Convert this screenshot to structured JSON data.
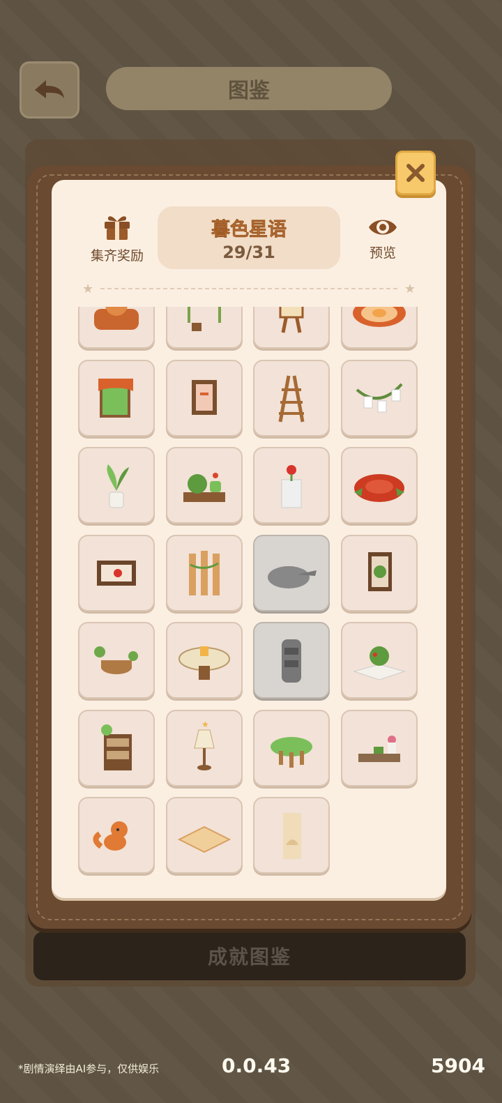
{
  "screen": {
    "title": "图鉴"
  },
  "modal": {
    "reward_label": "集齐奖励",
    "set_name": "暮色星语",
    "progress": "29/31",
    "preview_label": "预览"
  },
  "bottom_tab": {
    "label": "成就图鉴"
  },
  "footer": {
    "note": "*剧情演绎由AI参与，仅供娱乐",
    "version": "0.0.43",
    "count": "5904"
  },
  "items": [
    {
      "icon": "fox-sofa-icon",
      "locked": false
    },
    {
      "icon": "photo-swing-icon",
      "locked": false
    },
    {
      "icon": "painting-easel-icon",
      "locked": false
    },
    {
      "icon": "flower-rug-icon",
      "locked": false
    },
    {
      "icon": "vine-window-icon",
      "locked": false
    },
    {
      "icon": "picture-frame-icon",
      "locked": false
    },
    {
      "icon": "wooden-ladder-shelf-icon",
      "locked": false
    },
    {
      "icon": "card-garland-icon",
      "locked": false
    },
    {
      "icon": "potted-plant-icon",
      "locked": false
    },
    {
      "icon": "planter-bench-icon",
      "locked": false
    },
    {
      "icon": "rose-vase-stand-icon",
      "locked": false
    },
    {
      "icon": "rose-rug-icon",
      "locked": false
    },
    {
      "icon": "rose-painting-icon",
      "locked": false
    },
    {
      "icon": "vine-fence-icon",
      "locked": false
    },
    {
      "icon": "puddle-rug-icon",
      "locked": true
    },
    {
      "icon": "leaf-painting-icon",
      "locked": false
    },
    {
      "icon": "stump-table-icon",
      "locked": false
    },
    {
      "icon": "lantern-table-icon",
      "locked": false
    },
    {
      "icon": "tree-bookshelf-icon",
      "locked": true
    },
    {
      "icon": "pop-up-book-icon",
      "locked": false
    },
    {
      "icon": "bookshelf-icon",
      "locked": false
    },
    {
      "icon": "star-lamp-icon",
      "locked": false
    },
    {
      "icon": "leaf-stool-icon",
      "locked": false
    },
    {
      "icon": "plant-shelf-icon",
      "locked": false
    },
    {
      "icon": "fox-figure-icon",
      "locked": false
    },
    {
      "icon": "wood-floor-icon",
      "locked": false
    },
    {
      "icon": "fox-curtain-icon",
      "locked": false
    }
  ],
  "colors": {
    "card_bg": "#fbefe2",
    "frame": "#6a4a31",
    "cell_bg": "#f2e2d7",
    "locked_bg": "#d8d4cf",
    "accent": "#d5894a",
    "close_btn": "#f7c96a"
  }
}
